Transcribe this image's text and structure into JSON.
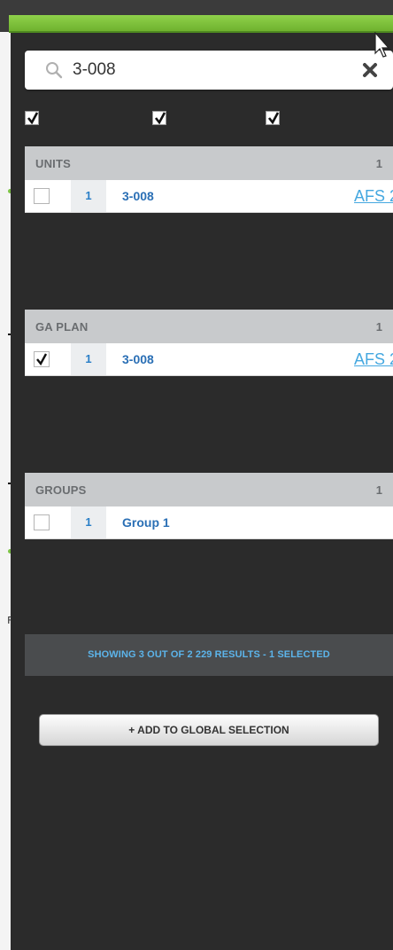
{
  "search": {
    "value": "3-008",
    "placeholder": ""
  },
  "column_checks": [
    true,
    true,
    true
  ],
  "sections": [
    {
      "title": "UNITS",
      "count": "1",
      "rows": [
        {
          "checked": false,
          "num": "1",
          "name": "3-008",
          "link": "AFS 2"
        }
      ]
    },
    {
      "title": "GA PLAN",
      "count": "1",
      "rows": [
        {
          "checked": true,
          "num": "1",
          "name": "3-008",
          "link": "AFS 2"
        }
      ]
    },
    {
      "title": "GROUPS",
      "count": "1",
      "rows": [
        {
          "checked": false,
          "num": "1",
          "name": "Group 1",
          "link": ""
        }
      ]
    }
  ],
  "results": {
    "text": "SHOWING 3 OUT OF 2 229 RESULTS - 1 SELECTED"
  },
  "add_button": {
    "label": "+ ADD TO GLOBAL SELECTION"
  },
  "background": {
    "stray_char": "F"
  },
  "colors": {
    "accent_green": "#7ac142",
    "panel": "#2b2b2b",
    "link_blue": "#45a8e0",
    "results_text": "#5cb4ea"
  },
  "icons": {
    "search": "search-icon",
    "clear": "close-icon",
    "cursor": "mouse-cursor-icon",
    "check": "checkmark-icon"
  }
}
